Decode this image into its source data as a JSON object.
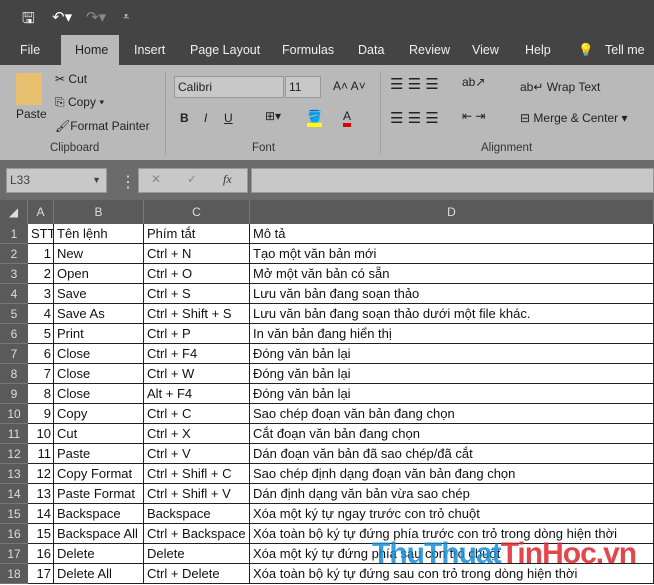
{
  "qat": {
    "save": "save-icon",
    "undo": "undo-icon",
    "redo": "redo-icon",
    "customize": "customize-icon"
  },
  "tabs": [
    "File",
    "Home",
    "Insert",
    "Page Layout",
    "Formulas",
    "Data",
    "Review",
    "View",
    "Help"
  ],
  "tell_me": "Tell me w",
  "clipboard": {
    "paste": "Paste",
    "cut": "Cut",
    "copy": "Copy",
    "format_painter": "Format Painter",
    "label": "Clipboard"
  },
  "font": {
    "name": "Calibri",
    "size": "11",
    "bold": "B",
    "italic": "I",
    "underline": "U",
    "label": "Font",
    "fill_color": "#ffff00",
    "font_color": "#e00000"
  },
  "alignment": {
    "wrap": "Wrap Text",
    "merge": "Merge & Center",
    "label": "Alignment"
  },
  "formula_bar": {
    "name_box": "L33",
    "cancel": "✕",
    "enter": "✓",
    "fx": "fx",
    "value": ""
  },
  "columns": [
    "A",
    "B",
    "C",
    "D"
  ],
  "rows": [
    [
      "STT",
      "Tên lệnh",
      "Phím tắt",
      "Mô tả"
    ],
    [
      "1",
      "New",
      "Ctrl + N",
      "Tạo một văn bản mới"
    ],
    [
      "2",
      "Open",
      "Ctrl + O",
      "Mở một văn bản có sẵn"
    ],
    [
      "3",
      "Save",
      "Ctrl + S",
      "Lưu văn bản đang soạn thảo"
    ],
    [
      "4",
      "Save As",
      "Ctrl + Shift + S",
      "Lưu văn bản đang soạn thảo dưới một file khác."
    ],
    [
      "5",
      "Print",
      "Ctrl + P",
      "In văn bản đang hiển thị"
    ],
    [
      "6",
      "Close",
      "Ctrl + F4",
      "Đóng văn bản lại"
    ],
    [
      "7",
      "Close",
      "Ctrl + W",
      "Đóng văn bản lại"
    ],
    [
      "8",
      "Close",
      "Alt + F4",
      "Đóng văn bản lại"
    ],
    [
      "9",
      "Copy",
      "Ctrl + C",
      "Sao chép đoạn văn bản đang chọn"
    ],
    [
      "10",
      "Cut",
      "Ctrl + X",
      "Cắt đoạn văn bản đang chọn"
    ],
    [
      "11",
      "Paste",
      "Ctrl + V",
      "Dán đoạn văn bản đã sao chép/đã cắt"
    ],
    [
      "12",
      "Copy Format",
      "Ctrl + Shifl + C",
      "Sao chép định dạng đoạn văn bản đang chọn"
    ],
    [
      "13",
      "Paste Format",
      "Ctrl + Shifl + V",
      "Dán định dạng văn bản vừa sao chép"
    ],
    [
      "14",
      "Backspace",
      "Backspace",
      "Xóa một ký tự ngay trước con trỏ chuột"
    ],
    [
      "15",
      "Backspace All",
      "Ctrl + Backspace",
      "Xóa toàn bộ ký tự đứng phía trước con trỏ trong dòng hiện thời"
    ],
    [
      "16",
      "Delete",
      "Delete",
      "Xóa một ký tự đứng phía sau con trỏ chuột"
    ],
    [
      "17",
      "Delete All",
      "Ctrl + Delete",
      "Xóa toàn bộ ký tự đứng sau con trỏ trong dòng hiện thời"
    ]
  ],
  "watermark": {
    "part1": "ThuThuat",
    "part2": "TinHoc.vn",
    "color1": "#1a8fd8",
    "color2": "#e0282c"
  }
}
